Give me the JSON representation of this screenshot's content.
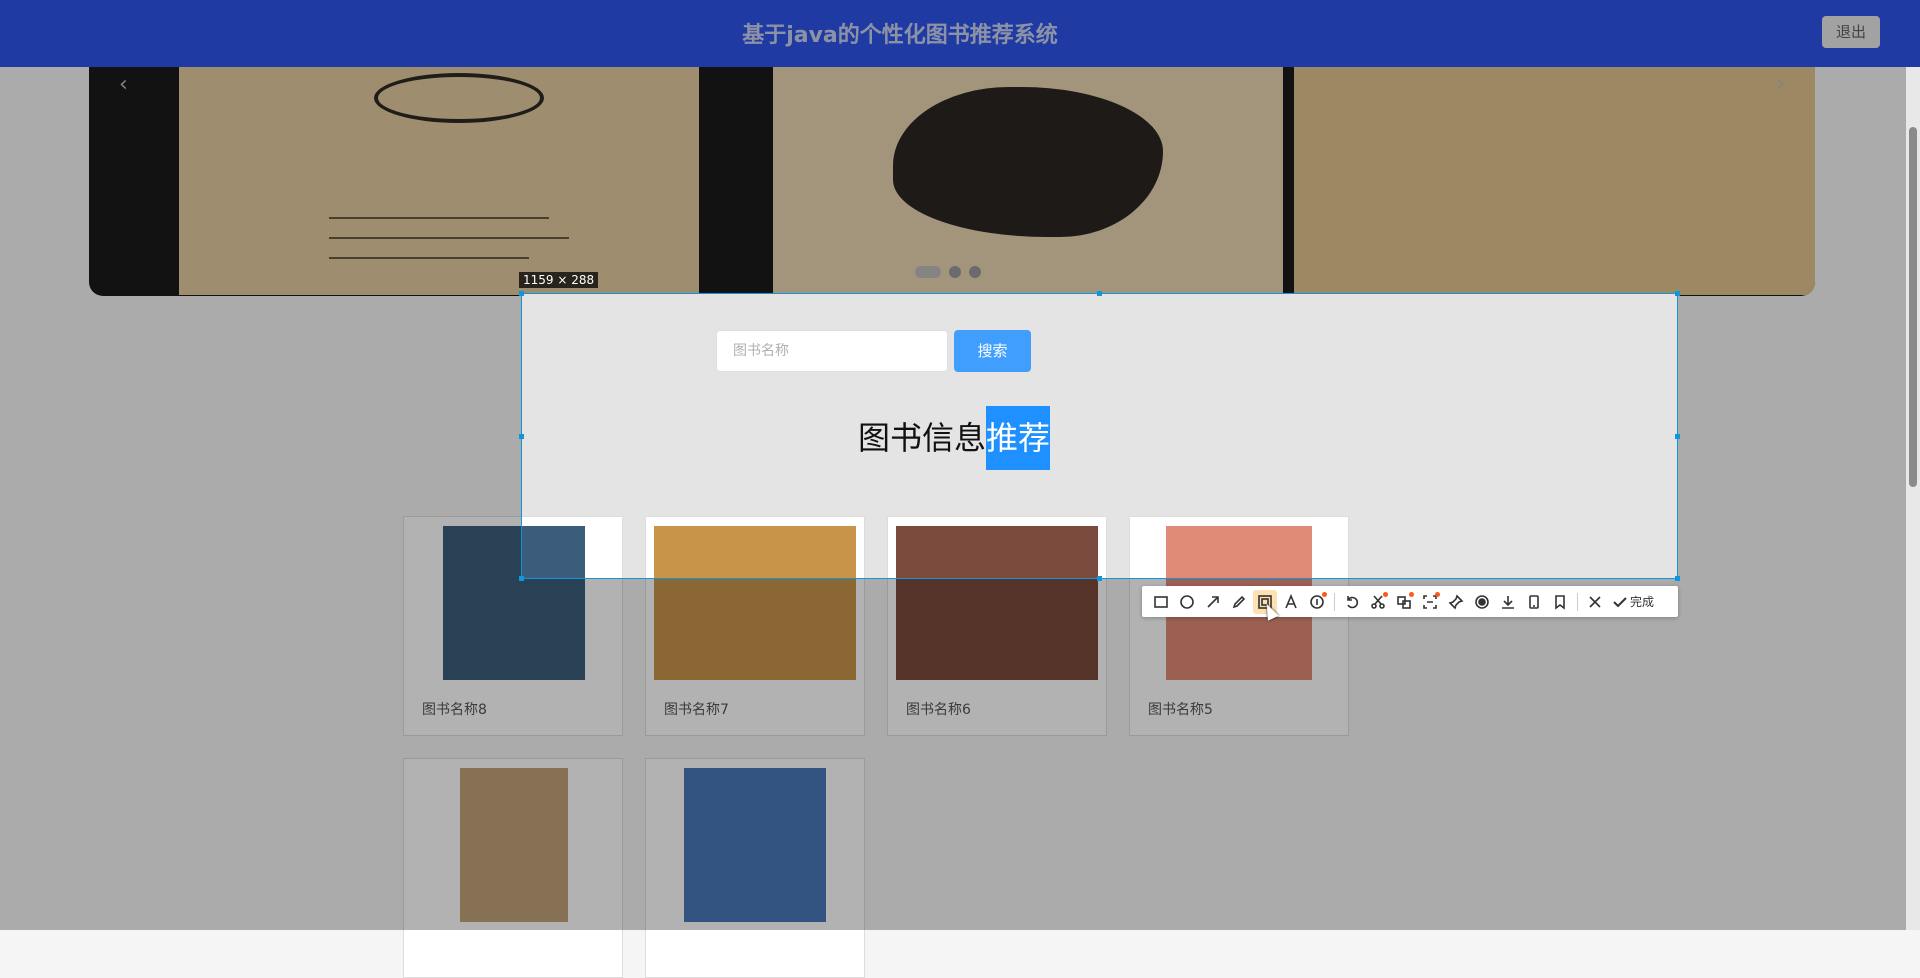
{
  "header": {
    "title": "基于java的个性化图书推荐系统",
    "logout_label": "退出"
  },
  "search": {
    "placeholder": "图书名称",
    "button_label": "搜索"
  },
  "section": {
    "title_main": "图书信息",
    "title_highlight": "推荐"
  },
  "books": [
    {
      "title": "图书名称8",
      "cover_color": "#3b5c7a"
    },
    {
      "title": "图书名称7",
      "cover_color": "#c8944a"
    },
    {
      "title": "图书名称6",
      "cover_color": "#7a4a3c"
    },
    {
      "title": "图书名称5",
      "cover_color": "#e08a78"
    },
    {
      "title": "",
      "cover_color": "#c2a27a"
    },
    {
      "title": "",
      "cover_color": "#4a78b8"
    }
  ],
  "screenshot_tool": {
    "size_label": "1159 × 288",
    "done_label": "完成",
    "selection_color": "#1296db"
  },
  "icons": {
    "carousel_prev": "chevron-left-icon",
    "carousel_next": "chevron-right-icon"
  }
}
